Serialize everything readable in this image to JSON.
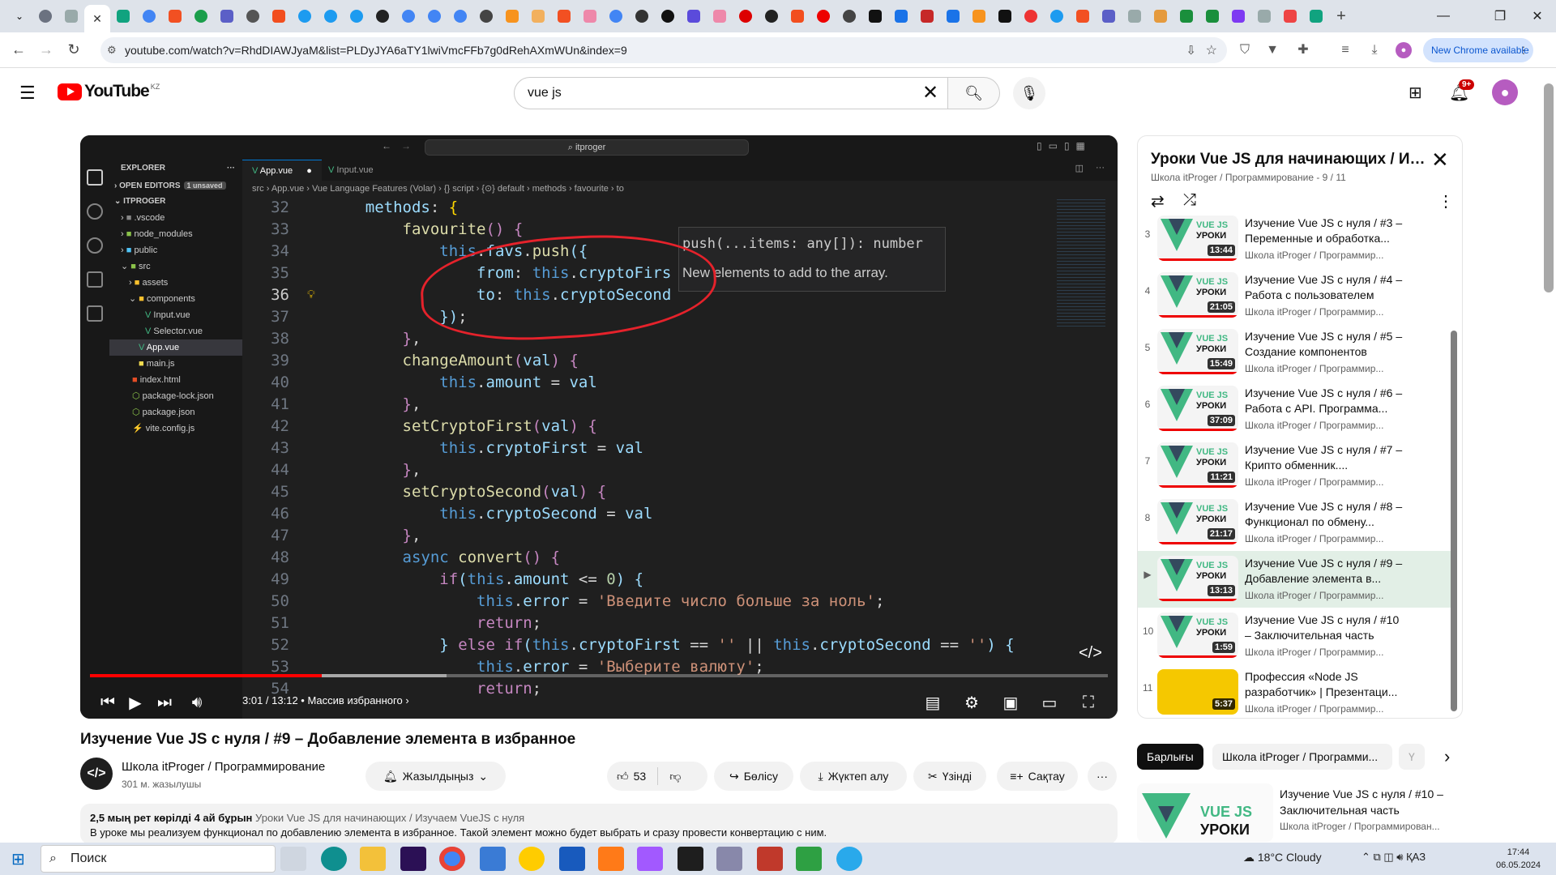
{
  "browser": {
    "url": "youtube.com/watch?v=RhdDIAWJyaM&list=PLDyJYA6aTY1lwiVmcFFb7g0dRehAXmWUn&index=9",
    "new_chrome_label": "New Chrome available"
  },
  "youtube": {
    "logo_text": "YouTube",
    "region": "KZ",
    "search_value": "vue js",
    "notif_count": "9+"
  },
  "vscode": {
    "command_center": "itproger",
    "explorer_title": "EXPLORER",
    "open_editors": "OPEN EDITORS",
    "unsaved": "1 unsaved",
    "project": "ITPROGER",
    "files": [
      ".vscode",
      "node_modules",
      "public",
      "src",
      "assets",
      "components",
      "Input.vue",
      "Selector.vue",
      "App.vue",
      "main.js",
      "index.html",
      "package-lock.json",
      "package.json",
      "vite.config.js"
    ],
    "tabs": [
      "App.vue",
      "Input.vue"
    ],
    "breadcrumb": "src  ›  App.vue  ›  Vue Language Features (Volar)  ›  {} script  ›  {⊙} default  ›  methods  ›  favourite  ›  to",
    "hover_sig": "push(...items: any[]): number",
    "hover_doc": "New elements to add to the array."
  },
  "player": {
    "time": "3:01 / 13:12",
    "chapter": "• Массив избранного",
    "progress_pct": 22.8
  },
  "video": {
    "title": "Изучение Vue JS с нуля / #9 – Добавление элемента в избранное",
    "channel": "Школа itProger / Программирование",
    "subs": "301 м. жазылушы",
    "subscribe": "Жазылдыңыз",
    "likes": "53",
    "share": "Бөлісу",
    "download": "Жүктеп алу",
    "clip": "Үзінді",
    "save": "Сақтау",
    "views_date": "2,5 мың рет көрілді  4 ай бұрын",
    "playlist_link": "Уроки Vue JS для начинающих / Изучаем VueJS с нуля",
    "description": "В уроке мы реализуем функционал по добавлению элемента в избранное. Такой элемент можно будет выбрать и сразу провести конвертацию с ним."
  },
  "playlist": {
    "title": "Уроки Vue JS для начинающих / Из...",
    "sub": "Школа itProger / Программирование - 9 / 11",
    "items": [
      {
        "idx": "3",
        "title": "Изучение Vue JS с нуля / #3 – Переменные и обработка...",
        "ch": "Школа itProger / Программир...",
        "dur": "13:44"
      },
      {
        "idx": "4",
        "title": "Изучение Vue JS с нуля / #4 – Работа с пользователем",
        "ch": "Школа itProger / Программир...",
        "dur": "21:05"
      },
      {
        "idx": "5",
        "title": "Изучение Vue JS с нуля / #5 – Создание компонентов",
        "ch": "Школа itProger / Программир...",
        "dur": "15:49"
      },
      {
        "idx": "6",
        "title": "Изучение Vue JS с нуля / #6 – Работа с API. Программа...",
        "ch": "Школа itProger / Программир...",
        "dur": "37:09"
      },
      {
        "idx": "7",
        "title": "Изучение Vue JS с нуля / #7 – Крипто обменник....",
        "ch": "Школа itProger / Программир...",
        "dur": "11:21"
      },
      {
        "idx": "8",
        "title": "Изучение Vue JS с нуля / #8 – Функционал по обмену...",
        "ch": "Школа itProger / Программир...",
        "dur": "21:17"
      },
      {
        "idx": "▶",
        "title": "Изучение Vue JS с нуля / #9 – Добавление элемента в...",
        "ch": "Школа itProger / Программир...",
        "dur": "13:13"
      },
      {
        "idx": "10",
        "title": "Изучение Vue JS с нуля / #10 – Заключительная часть",
        "ch": "Школа itProger / Программир...",
        "dur": "1:59"
      },
      {
        "idx": "11",
        "title": "Профессия «Node JS разработчик» | Презентаци...",
        "ch": "Школа itProger / Программир...",
        "dur": "5:37"
      }
    ]
  },
  "chips": [
    "Барлығы",
    "Школа itProger / Программи...",
    "Ү"
  ],
  "rec": {
    "title": "Изучение Vue JS с нуля / #10 – Заключительная часть",
    "channel": "Школа itProger / Программирован..."
  },
  "taskbar": {
    "search": "Поиск",
    "weather": "18°C  Cloudy",
    "lang": "ҚАЗ",
    "time": "17:44",
    "date": "06.05.2024"
  }
}
